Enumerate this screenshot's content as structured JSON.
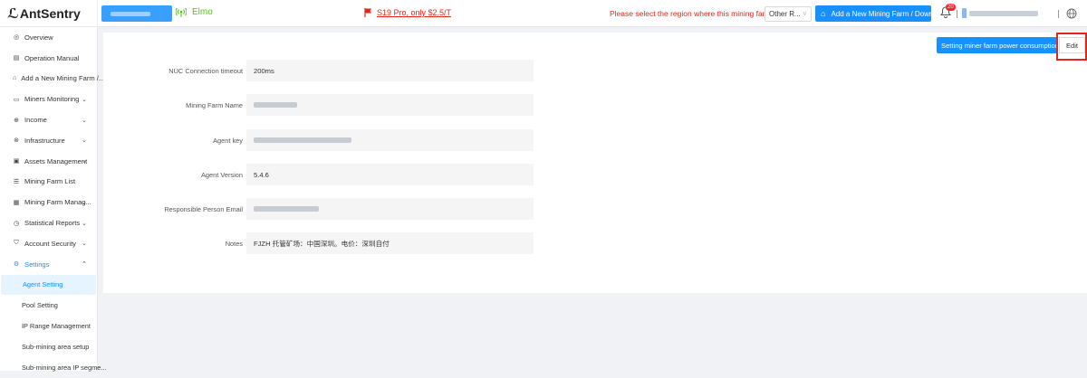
{
  "app": {
    "name": "AntSentry"
  },
  "header": {
    "signal_label": "Elmo",
    "promo_text": "S19 Pro, only $2.5/T",
    "region_message": "Please select the region where this mining farm is located:",
    "region_value": "Other R...",
    "add_farm_label": "Add a New Mining Farm / Download",
    "notification_count": "20",
    "accent_color": "#1890ff",
    "alert_color": "#e0281a"
  },
  "sidebar": {
    "items": [
      {
        "label": "Overview",
        "icon": "overview-icon"
      },
      {
        "label": "Operation Manual",
        "icon": "manual-icon"
      },
      {
        "label": "Add a New Mining Farm /...",
        "icon": "farm-icon"
      },
      {
        "label": "Miners Monitoring",
        "icon": "monitor-icon",
        "expandable": true
      },
      {
        "label": "Income",
        "icon": "income-icon",
        "expandable": true
      },
      {
        "label": "Infrastructure",
        "icon": "infrastructure-icon",
        "expandable": true
      },
      {
        "label": "Assets Management",
        "icon": "assets-icon",
        "expandable": true
      },
      {
        "label": "Mining Farm List",
        "icon": "list-icon"
      },
      {
        "label": "Mining Farm Manag...",
        "icon": "farm-manage-icon",
        "expandable": true
      },
      {
        "label": "Statistical Reports",
        "icon": "reports-icon",
        "expandable": true
      },
      {
        "label": "Account Security",
        "icon": "security-icon",
        "expandable": true
      },
      {
        "label": "Settings",
        "icon": "settings-icon",
        "expandable": true,
        "expanded": true
      }
    ],
    "settings_sub": [
      {
        "label": "Agent Setting",
        "selected": true
      },
      {
        "label": "Pool Setting"
      },
      {
        "label": "IP Range Management"
      },
      {
        "label": "Sub-mining area setup"
      },
      {
        "label": "Sub-mining area IP segme..."
      }
    ]
  },
  "main": {
    "power_button": "Setting miner farm power consumption",
    "edit_button": "Edit",
    "fields": [
      {
        "label": "NUC Connection timeout",
        "value": "200ms"
      },
      {
        "label": "Mining Farm Name",
        "value": ""
      },
      {
        "label": "Agent key",
        "value": ""
      },
      {
        "label": "Agent Version",
        "value": "5.4.6"
      },
      {
        "label": "Responsible Person Email",
        "value": ""
      },
      {
        "label": "Notes",
        "value": "FJZH 托管矿场：中国深圳。电价：深圳自付"
      }
    ]
  }
}
